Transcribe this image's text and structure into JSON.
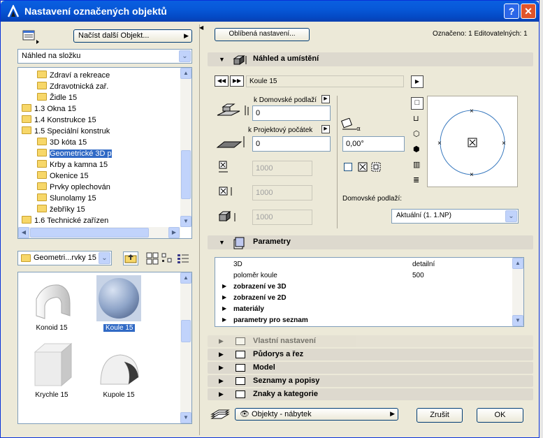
{
  "window": {
    "title": "Nastavení označených objektů"
  },
  "left": {
    "load_other_label": "Načíst další Objekt...",
    "view_select": "Náhled na složku",
    "tree": [
      {
        "label": "Zdraví a rekreace",
        "indent": 2
      },
      {
        "label": "Zdravotnická zař.",
        "indent": 2
      },
      {
        "label": "Židle 15",
        "indent": 2
      },
      {
        "label": "1.3 Okna 15",
        "indent": 1
      },
      {
        "label": "1.4 Konstrukce 15",
        "indent": 1,
        "expand": "+"
      },
      {
        "label": "1.5 Speciální konstruk",
        "indent": 1,
        "expand": "−"
      },
      {
        "label": "3D kóta 15",
        "indent": 2
      },
      {
        "label": "Geometrické 3D p",
        "indent": 2,
        "selected": true
      },
      {
        "label": "Krby a kamna 15",
        "indent": 2
      },
      {
        "label": "Okenice 15",
        "indent": 2
      },
      {
        "label": "Prvky oplechován",
        "indent": 2
      },
      {
        "label": "Slunolamy 15",
        "indent": 2
      },
      {
        "label": "žebříky 15",
        "indent": 2
      },
      {
        "label": "1.6 Technické zařízen",
        "indent": 1,
        "expand": "+"
      }
    ],
    "folder_select": "Geometri...rvky 15",
    "objects": [
      {
        "label": "Konoid 15"
      },
      {
        "label": "Koule 15",
        "selected": true
      },
      {
        "label": "Krychle 15"
      },
      {
        "label": "Kupole 15"
      }
    ]
  },
  "right": {
    "favorites_label": "Oblíbená nastavení...",
    "marked_text": "Označeno: 1 Editovatelných: 1",
    "section_preview": "Náhled a umístění",
    "object_name": "Koule 15",
    "home_story_label": "k Domovské podlaží",
    "home_story_value": "0",
    "project_zero_label": "k Projektový počátek",
    "project_zero_value": "0",
    "angle_value": "0,00°",
    "dim_values": [
      "1000",
      "1000",
      "1000"
    ],
    "home_floor_label": "Domovské podlaží:",
    "home_floor_value": "Aktuální (1. 1.NP)",
    "section_params": "Parametry",
    "params": [
      {
        "name": "3D",
        "value": "detailní"
      },
      {
        "name": "poloměr koule",
        "value": "500"
      },
      {
        "name": "zobrazení ve 3D",
        "value": "",
        "group": true
      },
      {
        "name": "zobrazení ve 2D",
        "value": "",
        "group": true
      },
      {
        "name": "materiály",
        "value": "",
        "group": true
      },
      {
        "name": "parametry pro seznam",
        "value": "",
        "group": true
      }
    ],
    "sections": [
      {
        "label": "Vlastní nastavení",
        "disabled": true
      },
      {
        "label": "Půdorys a řez"
      },
      {
        "label": "Model"
      },
      {
        "label": "Seznamy a popisy"
      },
      {
        "label": "Znaky a kategorie"
      }
    ],
    "layer_value": "Objekty - nábytek",
    "cancel_label": "Zrušit",
    "ok_label": "OK"
  }
}
